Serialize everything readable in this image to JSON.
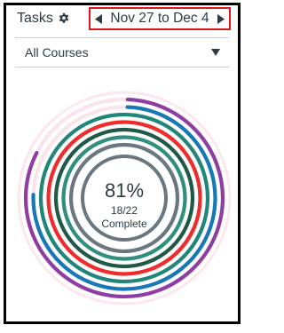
{
  "header": {
    "title": "Tasks",
    "settings_icon": "gear-icon",
    "date_range": "Nov 27 to Dec 4",
    "prev_icon": "triangle-left-icon",
    "next_icon": "triangle-right-icon",
    "highlight_color": "#e0161f"
  },
  "filter": {
    "selected": "All Courses",
    "caret_icon": "triangle-down-icon"
  },
  "progress": {
    "percent_label": "81%",
    "ratio_label": "18/22",
    "status_label": "Complete",
    "completed": 18,
    "total": 22
  },
  "chart_data": {
    "type": "radial-progress",
    "center": {
      "value": "81%",
      "sub": "18/22",
      "label": "Complete"
    },
    "rings": [
      {
        "color": "#8e3ea3",
        "track": "#fbe3ec",
        "fraction": 0.82
      },
      {
        "color": "#1778b8",
        "track": "#fbe3ec",
        "fraction": 0.75
      },
      {
        "color": "#20867a",
        "track": "#fbe3ec",
        "fraction": 1.0
      },
      {
        "color": "#ef2b2b",
        "track": "#fbe3ec",
        "fraction": 1.0
      },
      {
        "color": "#1e5a45",
        "track": "#fbe3ec",
        "fraction": 1.0
      },
      {
        "color": "#2e8f7f",
        "track": "#fbe3ec",
        "fraction": 1.0
      },
      {
        "color": "#6b7780",
        "track": "#fbe3ec",
        "fraction": 1.0
      }
    ]
  }
}
